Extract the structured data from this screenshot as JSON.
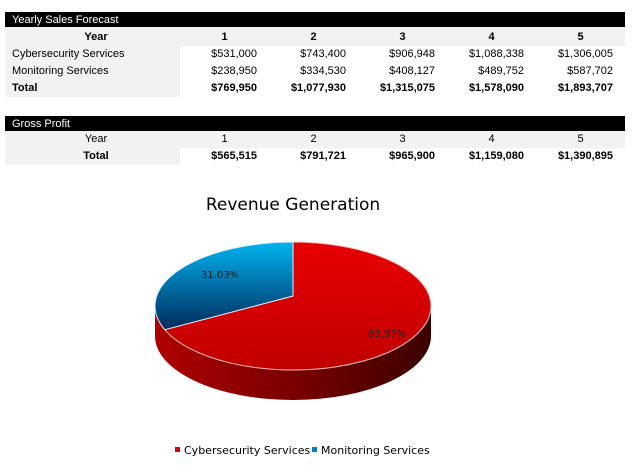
{
  "sales": {
    "title": "Yearly Sales Forecast",
    "year_label": "Year",
    "years": [
      "1",
      "2",
      "3",
      "4",
      "5"
    ],
    "rows": [
      {
        "label": "Cybersecurity Services",
        "values": [
          "$531,000",
          "$743,400",
          "$906,948",
          "$1,088,338",
          "$1,306,005"
        ]
      },
      {
        "label": "Monitoring Services",
        "values": [
          "$238,950",
          "$334,530",
          "$408,127",
          "$489,752",
          "$587,702"
        ]
      },
      {
        "label": "Total",
        "values": [
          "$769,950",
          "$1,077,930",
          "$1,315,075",
          "$1,578,090",
          "$1,893,707"
        ]
      }
    ]
  },
  "profit": {
    "title": "Gross Profit",
    "year_label": "Year",
    "years": [
      "1",
      "2",
      "3",
      "4",
      "5"
    ],
    "total_label": "Total",
    "totals": [
      "$565,515",
      "$791,721",
      "$965,900",
      "$1,159,080",
      "$1,390,895"
    ]
  },
  "chart_data": {
    "type": "pie",
    "title": "Revenue Generation",
    "style": "3d",
    "categories": [
      "Cybersecurity Services",
      "Monitoring Services"
    ],
    "values": [
      68.97,
      31.03
    ],
    "labels": [
      "68.97%",
      "31.03%"
    ],
    "colors": [
      "#e00000",
      "#00a0e0"
    ],
    "legend": "bottom"
  }
}
